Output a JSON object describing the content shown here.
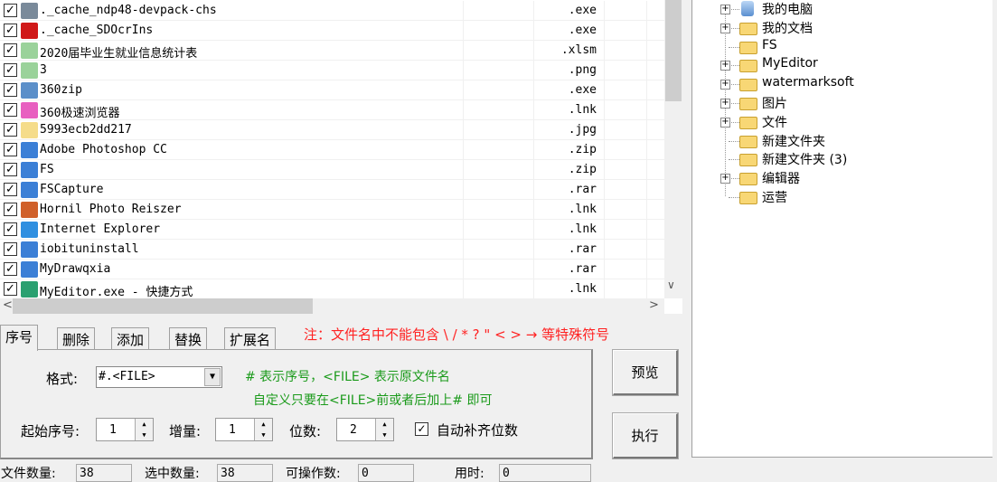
{
  "files": [
    {
      "name": "._cache_ndp48-devpack-chs",
      "ext": ".exe",
      "icon": "installer-icon",
      "color": "#7a8a9a"
    },
    {
      "name": "._cache_SDOcrIns",
      "ext": ".exe",
      "icon": "ocr-app-icon",
      "color": "#d01818"
    },
    {
      "name": "2020届毕业生就业信息统计表",
      "ext": ".xlsm",
      "icon": "spreadsheet-icon",
      "color": "#9ad29a"
    },
    {
      "name": "3",
      "ext": ".png",
      "icon": "image-file-icon",
      "color": "#9ad29a"
    },
    {
      "name": "360zip",
      "ext": ".exe",
      "icon": "360zip-icon",
      "color": "#5b8fc9"
    },
    {
      "name": "360极速浏览器",
      "ext": ".lnk",
      "icon": "browser-360-icon",
      "color": "#e85fc0"
    },
    {
      "name": "5993ecb2dd217",
      "ext": ".jpg",
      "icon": "jpg-file-icon",
      "color": "#f5dc8a"
    },
    {
      "name": "Adobe Photoshop CC",
      "ext": ".zip",
      "icon": "archive-icon",
      "color": "#3b7fd6"
    },
    {
      "name": "FS",
      "ext": ".zip",
      "icon": "archive-icon",
      "color": "#3b7fd6"
    },
    {
      "name": "FSCapture",
      "ext": ".rar",
      "icon": "archive-icon",
      "color": "#3b7fd6"
    },
    {
      "name": "Hornil Photo Reiszer",
      "ext": ".lnk",
      "icon": "photo-resizer-icon",
      "color": "#d0602a"
    },
    {
      "name": "Internet Explorer",
      "ext": ".lnk",
      "icon": "internet-explorer-icon",
      "color": "#2f8fe0"
    },
    {
      "name": "iobituninstall",
      "ext": ".rar",
      "icon": "archive-icon",
      "color": "#3b7fd6"
    },
    {
      "name": "MyDrawqxia",
      "ext": ".rar",
      "icon": "archive-icon",
      "color": "#3b7fd6"
    },
    {
      "name": "MyEditor.exe - 快捷方式",
      "ext": ".lnk",
      "icon": "myeditor-icon",
      "color": "#2aa070"
    }
  ],
  "tree": [
    {
      "label": "我的电脑",
      "expand": true,
      "icon": "computer-icon"
    },
    {
      "label": "我的文档",
      "expand": true,
      "icon": "folder-icon"
    },
    {
      "label": "FS",
      "expand": false,
      "icon": "folder-icon"
    },
    {
      "label": "MyEditor",
      "expand": true,
      "icon": "folder-icon"
    },
    {
      "label": "watermarksoft",
      "expand": true,
      "icon": "folder-icon"
    },
    {
      "label": "图片",
      "expand": true,
      "icon": "folder-icon"
    },
    {
      "label": "文件",
      "expand": true,
      "icon": "folder-icon"
    },
    {
      "label": "新建文件夹",
      "expand": false,
      "icon": "folder-icon"
    },
    {
      "label": "新建文件夹 (3)",
      "expand": false,
      "icon": "folder-icon"
    },
    {
      "label": "编辑器",
      "expand": true,
      "icon": "folder-icon"
    },
    {
      "label": "运营",
      "expand": false,
      "icon": "folder-icon"
    }
  ],
  "tabs": [
    "序号",
    "删除",
    "添加",
    "替换",
    "扩展名"
  ],
  "note": "注：文件名中不能包含 \\ /  * ? \" < > → 等特殊符号",
  "form": {
    "format_label": "格式:",
    "format_value": "#.<FILE>",
    "hint1": "# 表示序号，<FILE> 表示原文件名",
    "hint2": "自定义只要在<FILE>前或者后加上# 即可",
    "start_label": "起始序号:",
    "start_value": "1",
    "step_label": "增量:",
    "step_value": "1",
    "digits_label": "位数:",
    "digits_value": "2",
    "auto_pad_label": "自动补齐位数",
    "auto_pad_checked": true
  },
  "buttons": {
    "preview": "预览",
    "execute": "执行"
  },
  "status": {
    "file_count_label": "文件数量:",
    "file_count": "38",
    "selected_label": "选中数量:",
    "selected": "38",
    "operable_label": "可操作数:",
    "operable": "0",
    "time_label": "用时:",
    "time": "0"
  },
  "glyphs": {
    "check": "✓",
    "plus": "+",
    "down": "▼",
    "up_small": "▲",
    "down_small": "▼",
    "left": "<",
    "right": ">",
    "vdown": "∨"
  }
}
